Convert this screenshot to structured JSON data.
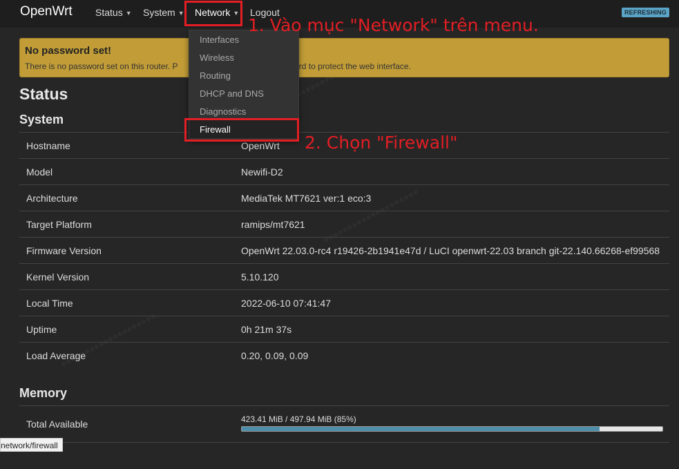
{
  "nav": {
    "brand": "OpenWrt",
    "status": "Status",
    "system": "System",
    "network": "Network",
    "logout": "Logout",
    "refreshing": "REFRESHING"
  },
  "network_menu": {
    "items": [
      "Interfaces",
      "Wireless",
      "Routing",
      "DHCP and DNS",
      "Diagnostics",
      "Firewall"
    ],
    "active": "Firewall"
  },
  "annotations": {
    "step1": "1. Vào mục \"Network\" trên menu.",
    "step2": "2. Chọn \"Firewall\""
  },
  "alert": {
    "title": "No password set!",
    "message_start": "There is no password set on this router. P",
    "message_end": "sword to protect the web interface."
  },
  "page_title": "Status",
  "system": {
    "heading": "System",
    "rows": [
      {
        "label": "Hostname",
        "value": "OpenWrt"
      },
      {
        "label": "Model",
        "value": "Newifi-D2"
      },
      {
        "label": "Architecture",
        "value": "MediaTek MT7621 ver:1 eco:3"
      },
      {
        "label": "Target Platform",
        "value": "ramips/mt7621"
      },
      {
        "label": "Firmware Version",
        "value": "OpenWrt 22.03.0-rc4 r19426-2b1941e47d / LuCI openwrt-22.03 branch git-22.140.66268-ef99568"
      },
      {
        "label": "Kernel Version",
        "value": "5.10.120"
      },
      {
        "label": "Local Time",
        "value": "2022-06-10 07:41:47"
      },
      {
        "label": "Uptime",
        "value": "0h 21m 37s"
      },
      {
        "label": "Load Average",
        "value": "0.20, 0.09, 0.09"
      }
    ]
  },
  "memory": {
    "heading": "Memory",
    "total_label": "Total Available",
    "total_value": "423.41 MiB / 497.94 MiB (85%)",
    "total_fraction": 0.85
  },
  "status_bar_url": "network/firewall",
  "colors": {
    "annotation": "#e31e24",
    "alert": "#c29d37",
    "progress": "#4d8faa"
  }
}
